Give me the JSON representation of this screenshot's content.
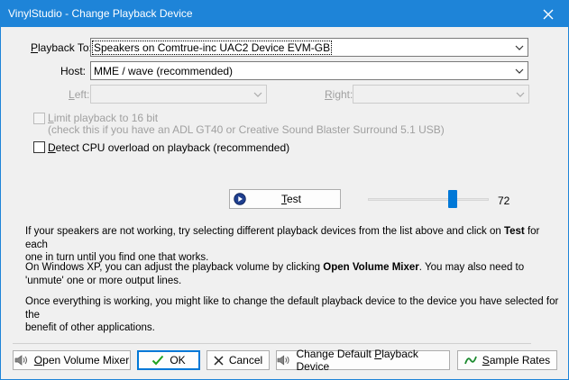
{
  "window": {
    "title": "VinylStudio - Change Playback Device",
    "colors": {
      "titlebar": "#1e84d8",
      "face": "#f0f0f0",
      "accent": "#0078d7"
    }
  },
  "playback_to": {
    "label_pre": "P",
    "label_rest": "layback To:",
    "value": "Speakers on Comtrue-inc UAC2 Device EVM-GB"
  },
  "host": {
    "label": "Host:",
    "value": "MME / wave (recommended)"
  },
  "left": {
    "label_pre": "L",
    "label_rest": "eft:",
    "value": ""
  },
  "right": {
    "label_pre": "R",
    "label_rest": "ight:",
    "value": ""
  },
  "limit_16bit": {
    "label_pre": "L",
    "label_rest": "imit playback to 16 bit",
    "hint": "(check this if you have an ADL GT40 or Creative Sound Blaster Surround 5.1 USB)",
    "checked": false,
    "enabled": false
  },
  "detect_cpu": {
    "label_pre": "D",
    "label_rest": "etect CPU overload on playback (recommended)",
    "checked": false
  },
  "test": {
    "label_pre": "T",
    "label_rest": "est",
    "icon": "play-icon"
  },
  "volume": {
    "level": 72,
    "display": "72"
  },
  "info": {
    "p1_pre": "If your speakers are not working, try selecting different playback devices from the list above and click on ",
    "p1_bold": "Test",
    "p1_mid": " for each",
    "p1_line2": "one in turn until you find one that works.",
    "p2_pre": "On Windows XP, you can adjust the playback volume by clicking ",
    "p2_bold": "Open Volume Mixer",
    "p2_post": ".  You may also need to",
    "p2_line2": "'unmute' one or more output lines.",
    "p3_line1": "Once everything is working, you might like to change the default playback device to the device you have selected for the",
    "p3_line2": "benefit of other applications."
  },
  "buttons": {
    "open_mixer": {
      "label_pre": "O",
      "label_rest": "pen Volume Mixer",
      "icon": "speaker-icon"
    },
    "ok": {
      "label": "OK",
      "icon": "checkmark-icon"
    },
    "cancel": {
      "label": "Cancel",
      "icon": "x-icon"
    },
    "change_default": {
      "label_pre": "Change Default ",
      "label_u": "P",
      "label_rest": "layback Device",
      "icon": "speaker-icon"
    },
    "sample_rates": {
      "label_pre": "S",
      "label_rest": "ample Rates",
      "icon": "wave-icon"
    }
  }
}
